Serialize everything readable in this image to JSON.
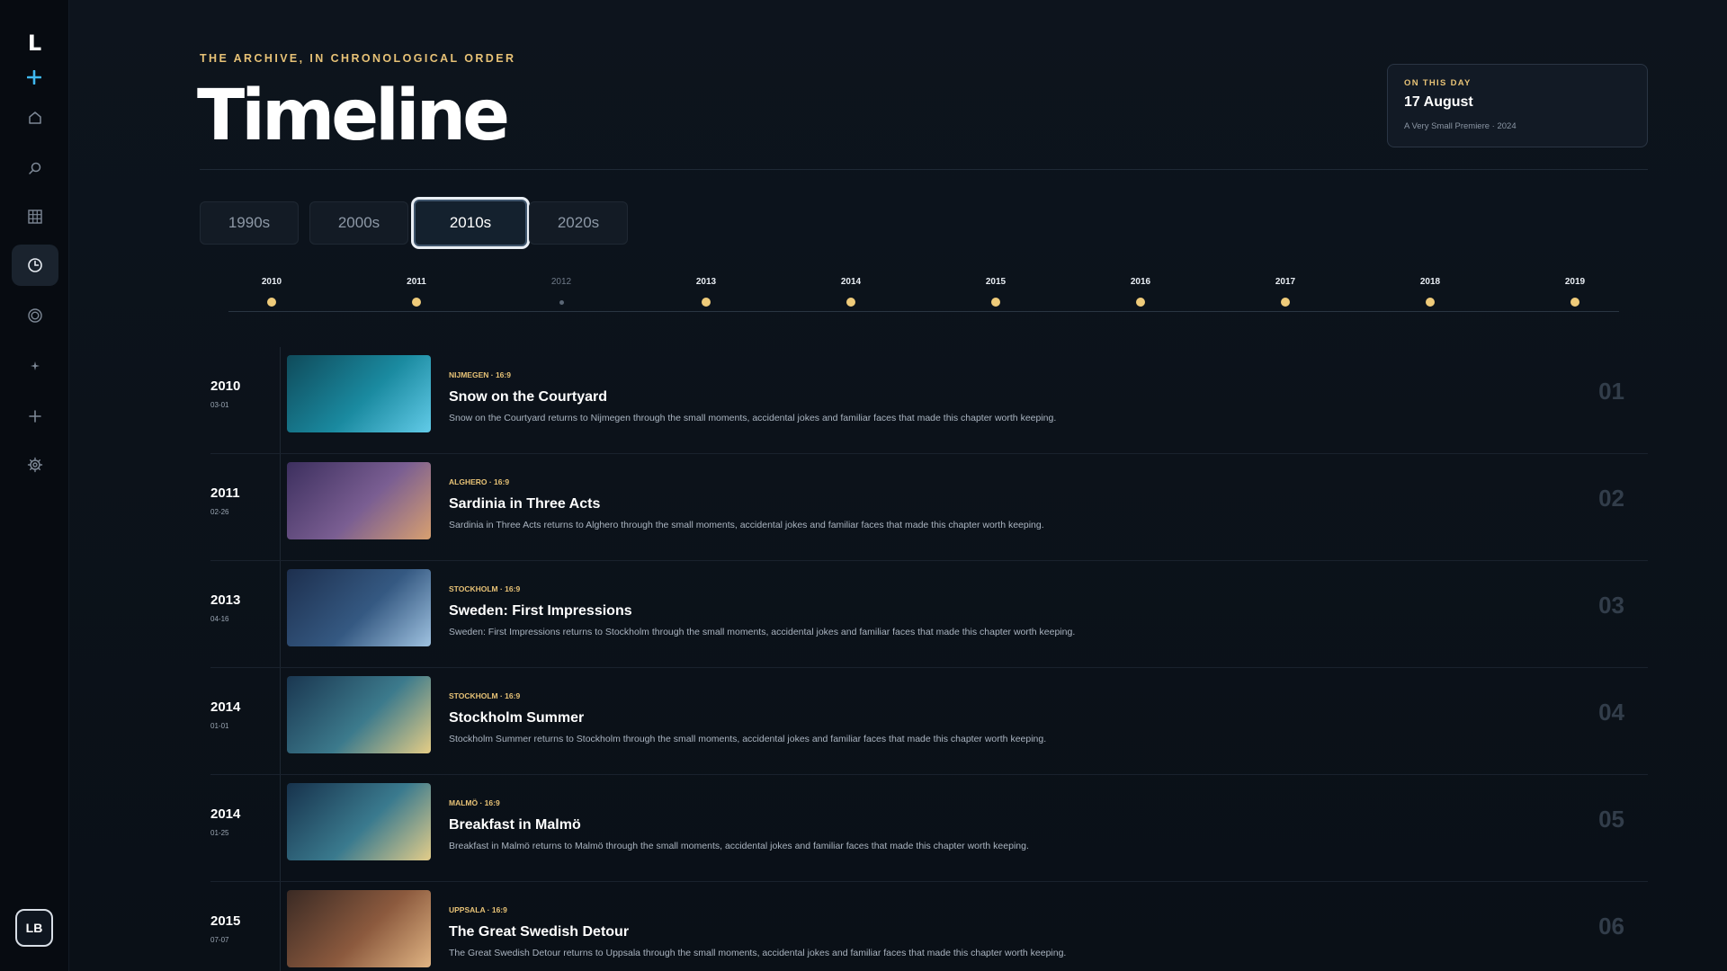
{
  "sidebar": {
    "logo": "L",
    "new_icon": "plus",
    "items": [
      {
        "icon": "home-icon"
      },
      {
        "icon": "search-icon"
      },
      {
        "icon": "grid-icon"
      },
      {
        "icon": "clock-icon",
        "active": true
      },
      {
        "icon": "target-icon"
      },
      {
        "icon": "sparkle-icon"
      },
      {
        "icon": "plus-icon"
      },
      {
        "icon": "gear-icon"
      }
    ],
    "avatar": "LB"
  },
  "header": {
    "eyebrow": "THE ARCHIVE, IN CHRONOLOGICAL ORDER",
    "title": "Timeline"
  },
  "on_this_day": {
    "label": "ON THIS DAY",
    "date": "17 August",
    "subtitle": "A Very Small Premiere · 2024"
  },
  "decades": [
    {
      "label": "1990s",
      "active": false
    },
    {
      "label": "2000s",
      "active": false
    },
    {
      "label": "2010s",
      "active": true
    },
    {
      "label": "2020s",
      "active": false
    }
  ],
  "years": [
    {
      "label": "2010",
      "has_entries": true
    },
    {
      "label": "2011",
      "has_entries": true
    },
    {
      "label": "2012",
      "has_entries": false
    },
    {
      "label": "2013",
      "has_entries": true
    },
    {
      "label": "2014",
      "has_entries": true
    },
    {
      "label": "2015",
      "has_entries": true
    },
    {
      "label": "2016",
      "has_entries": true
    },
    {
      "label": "2017",
      "has_entries": true
    },
    {
      "label": "2018",
      "has_entries": true
    },
    {
      "label": "2019",
      "has_entries": true
    }
  ],
  "entries": [
    {
      "year": "2010",
      "date": "03-01",
      "meta": "NIJMEGEN · 16:9",
      "title": "Snow on the Courtyard",
      "description": "Snow on the Courtyard returns to Nijmegen through the small moments, accidental jokes and familiar faces that made this chapter worth keeping.",
      "number": "01",
      "thumb_colors": [
        "#0f4a5a",
        "#1a8aa0",
        "#62cbe8"
      ]
    },
    {
      "year": "2011",
      "date": "02-26",
      "meta": "ALGHERO · 16:9",
      "title": "Sardinia in Three Acts",
      "description": "Sardinia in Three Acts returns to Alghero through the small moments, accidental jokes and familiar faces that made this chapter worth keeping.",
      "number": "02",
      "thumb_colors": [
        "#3c2f5e",
        "#7a5e92",
        "#d8a070"
      ]
    },
    {
      "year": "2013",
      "date": "04-16",
      "meta": "STOCKHOLM · 16:9",
      "title": "Sweden: First Impressions",
      "description": "Sweden: First Impressions returns to Stockholm through the small moments, accidental jokes and familiar faces that made this chapter worth keeping.",
      "number": "03",
      "thumb_colors": [
        "#1d2f4e",
        "#355982",
        "#9fc2e0"
      ]
    },
    {
      "year": "2014",
      "date": "01-01",
      "meta": "STOCKHOLM · 16:9",
      "title": "Stockholm Summer",
      "description": "Stockholm Summer returns to Stockholm through the small moments, accidental jokes and familiar faces that made this chapter worth keeping.",
      "number": "04",
      "thumb_colors": [
        "#1a3650",
        "#3c7a8c",
        "#e5cd86"
      ]
    },
    {
      "year": "2014",
      "date": "01-25",
      "meta": "MALMÖ · 16:9",
      "title": "Breakfast in Malmö",
      "description": "Breakfast in Malmö returns to Malmö through the small moments, accidental jokes and familiar faces that made this chapter worth keeping.",
      "number": "05",
      "thumb_colors": [
        "#17324c",
        "#3a7a8e",
        "#e3cd8a"
      ]
    },
    {
      "year": "2015",
      "date": "07-07",
      "meta": "UPPSALA · 16:9",
      "title": "The Great Swedish Detour",
      "description": "The Great Swedish Detour returns to Uppsala through the small moments, accidental jokes and familiar faces that made this chapter worth keeping.",
      "number": "06",
      "thumb_colors": [
        "#3a2a24",
        "#8c5a3e",
        "#e0b483"
      ]
    }
  ],
  "colors": {
    "accent_gold": "#e7c276",
    "background": "#0b1119",
    "sidebar": "#070b11",
    "active_tab_ring": "#e9eef4"
  }
}
